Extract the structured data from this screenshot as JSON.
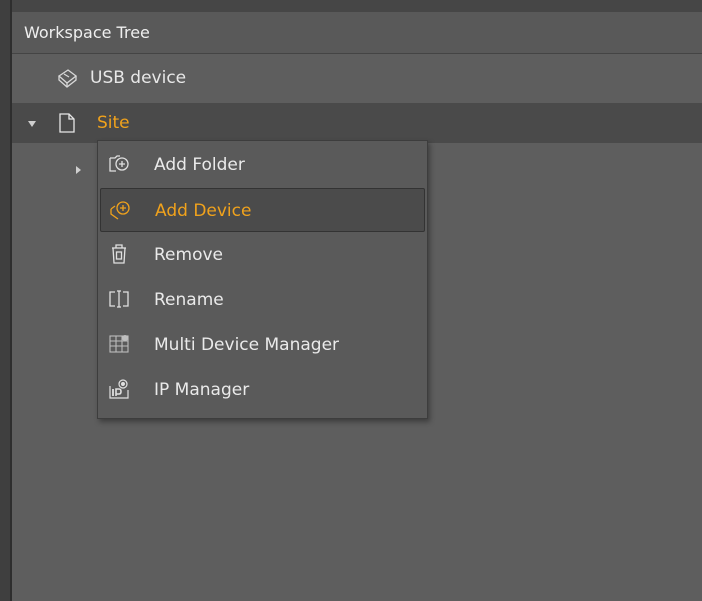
{
  "panel": {
    "title": "Workspace Tree"
  },
  "tree": {
    "items": [
      {
        "label": "USB device",
        "icon": "usb-device-icon",
        "expanded": false
      },
      {
        "label": "Site",
        "icon": "document-icon",
        "expanded": true,
        "selected": true,
        "label_color": "#f0a21c"
      }
    ],
    "child_expander_icon": "chevron-right-icon"
  },
  "context_menu": {
    "items": [
      {
        "label": "Add Folder",
        "icon": "add-folder-icon"
      },
      {
        "label": "Add Device",
        "icon": "add-device-icon",
        "highlighted": true
      },
      {
        "label": "Remove",
        "icon": "trash-icon"
      },
      {
        "label": "Rename",
        "icon": "rename-icon"
      },
      {
        "label": "Multi Device Manager",
        "icon": "multi-device-manager-icon"
      },
      {
        "label": "IP Manager",
        "icon": "ip-manager-icon"
      }
    ]
  },
  "colors": {
    "accent": "#f0a21c",
    "background": "#5e5e5e",
    "menu_background": "#5a5a5a",
    "text": "#e6e6e6"
  }
}
